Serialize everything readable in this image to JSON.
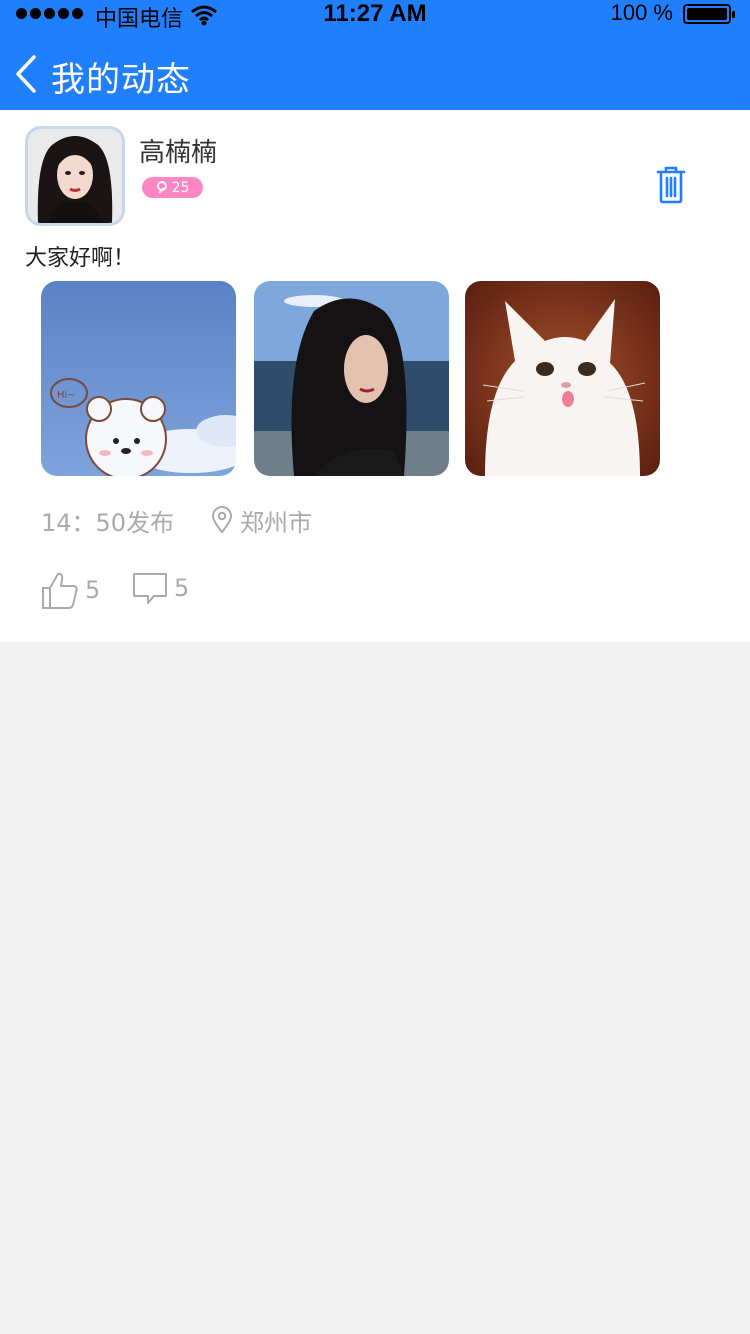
{
  "status_bar": {
    "carrier": "中国电信",
    "time": "11:27 AM",
    "battery_percent": "100 %"
  },
  "nav": {
    "back_icon": "chevron-left-icon",
    "title": "我的动态"
  },
  "post": {
    "user": {
      "name": "高楠楠",
      "gender_icon": "female-icon",
      "age": "25"
    },
    "text": "大家好啊！",
    "images": [
      "bear-cloud-photo",
      "girl-portrait-photo",
      "white-cat-photo"
    ],
    "publish_time": "14：50发布",
    "location": "郑州市",
    "likes": "5",
    "comments": "5"
  },
  "colors": {
    "primary": "#1f7ffd",
    "badge": "#ff86c4",
    "meta_text": "#aaaaaa",
    "background": "#f1f1f1"
  }
}
